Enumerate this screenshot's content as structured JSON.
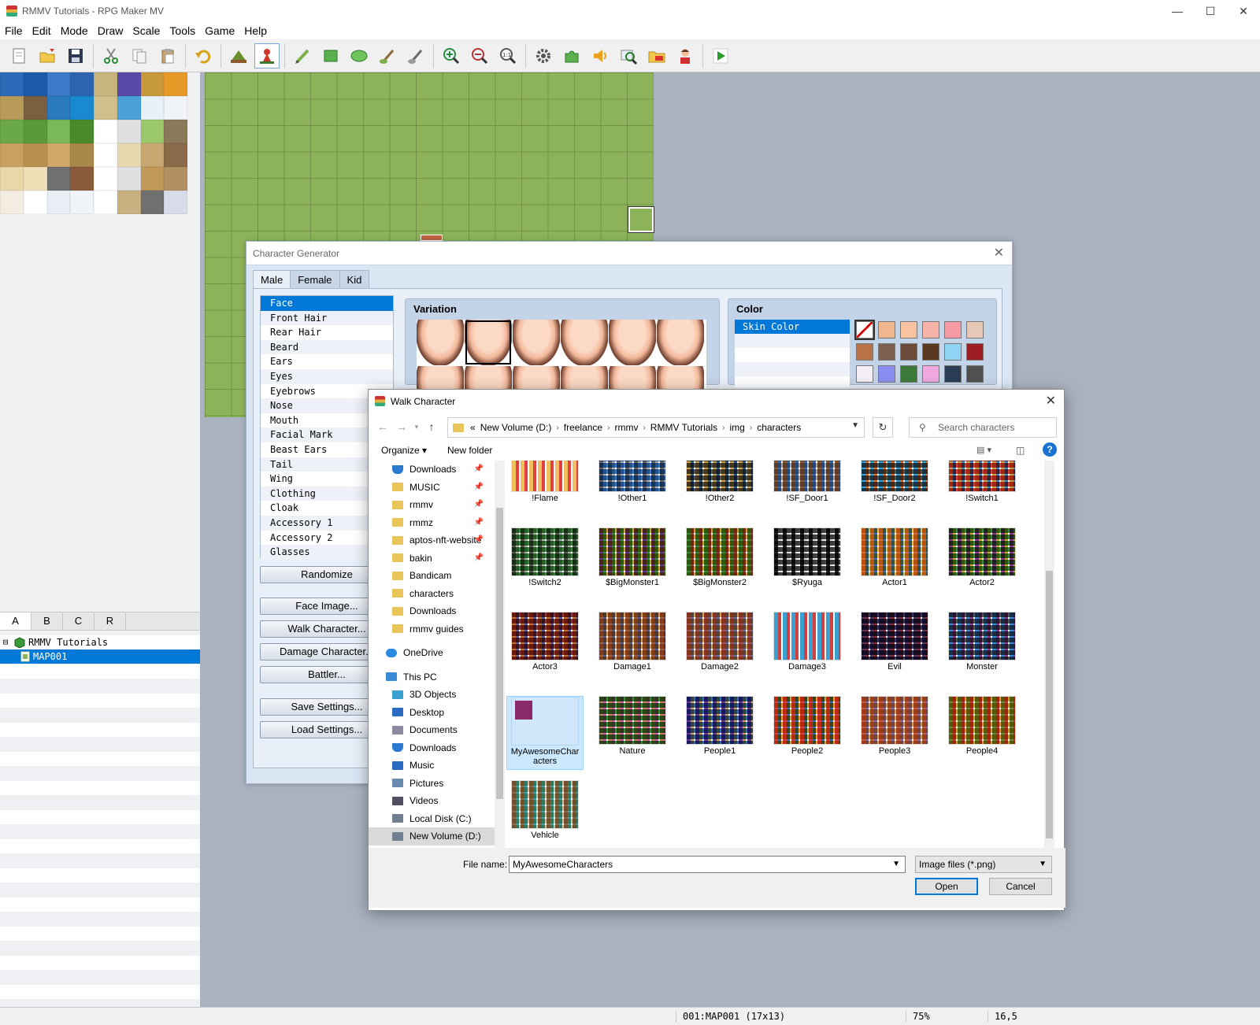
{
  "window": {
    "title": "RMMV Tutorials - RPG Maker MV",
    "min": "—",
    "max": "☐",
    "close": "✕"
  },
  "menu": [
    "File",
    "Edit",
    "Mode",
    "Draw",
    "Scale",
    "Tools",
    "Game",
    "Help"
  ],
  "layer_tabs": [
    "A",
    "B",
    "C",
    "R"
  ],
  "tree": {
    "project": "RMMV Tutorials",
    "map": "MAP001",
    "expander": "⊟"
  },
  "status": {
    "map": "001:MAP001 (17x13)",
    "zoom": "75%",
    "coords": "16,5"
  },
  "chargen": {
    "title": "Character Generator",
    "close": "✕",
    "tabs": [
      "Male",
      "Female",
      "Kid"
    ],
    "parts": [
      "Face",
      "Front Hair",
      "Rear Hair",
      "Beard",
      "Ears",
      "Eyes",
      "Eyebrows",
      "Nose",
      "Mouth",
      "Facial Mark",
      "Beast Ears",
      "Tail",
      "Wing",
      "Clothing",
      "Cloak",
      "Accessory 1",
      "Accessory 2",
      "Glasses"
    ],
    "buttons": {
      "randomize": "Randomize",
      "face_image": "Face Image...",
      "walk_character": "Walk Character...",
      "damage_character": "Damage Character...",
      "battler": "Battler...",
      "save_settings": "Save Settings...",
      "load_settings": "Load Settings..."
    },
    "variation_label": "Variation",
    "color_label": "Color",
    "color_list": [
      "Skin Color"
    ],
    "swatches": [
      "#ffffff",
      "#f0b68e",
      "#f7c3a0",
      "#f7b3a8",
      "#f59aa3",
      "#e7c7b6",
      "#b87348",
      "#7d5f4f",
      "#6b4a38",
      "#5a3720",
      "#8fd3f5",
      "#9c1c22",
      "#f2eef4",
      "#8a8ef0",
      "#3d7a3a",
      "#f0a8e0",
      "#2a3d55",
      "#505050"
    ]
  },
  "dialog": {
    "title": "Walk Character",
    "close": "✕",
    "path": [
      "New Volume (D:)",
      "freelance",
      "rmmv",
      "RMMV Tutorials",
      "img",
      "characters"
    ],
    "path_prefix": "«",
    "search_placeholder": "Search characters",
    "organize": "Organize ▾",
    "new_folder": "New folder",
    "nav": [
      {
        "label": "Downloads",
        "pin": true,
        "kind": "download"
      },
      {
        "label": "MUSIC",
        "pin": true,
        "kind": "folder"
      },
      {
        "label": "rmmv",
        "pin": true,
        "kind": "folder"
      },
      {
        "label": "rmmz",
        "pin": true,
        "kind": "folder"
      },
      {
        "label": "aptos-nft-website",
        "pin": true,
        "kind": "folder"
      },
      {
        "label": "bakin",
        "pin": true,
        "kind": "folder"
      },
      {
        "label": "Bandicam",
        "pin": false,
        "kind": "folder"
      },
      {
        "label": "characters",
        "pin": false,
        "kind": "folder"
      },
      {
        "label": "Downloads",
        "pin": false,
        "kind": "folder"
      },
      {
        "label": "rmmv guides",
        "pin": false,
        "kind": "folder"
      },
      {
        "label": "",
        "pin": false,
        "kind": "gap"
      },
      {
        "label": "OneDrive",
        "pin": false,
        "kind": "cloud"
      },
      {
        "label": "",
        "pin": false,
        "kind": "gap"
      },
      {
        "label": "This PC",
        "pin": false,
        "kind": "pc"
      },
      {
        "label": "3D Objects",
        "pin": false,
        "kind": "obj"
      },
      {
        "label": "Desktop",
        "pin": false,
        "kind": "desk"
      },
      {
        "label": "Documents",
        "pin": false,
        "kind": "doc"
      },
      {
        "label": "Downloads",
        "pin": false,
        "kind": "download"
      },
      {
        "label": "Music",
        "pin": false,
        "kind": "music"
      },
      {
        "label": "Pictures",
        "pin": false,
        "kind": "pic"
      },
      {
        "label": "Videos",
        "pin": false,
        "kind": "vid"
      },
      {
        "label": "Local Disk (C:)",
        "pin": false,
        "kind": "disk"
      },
      {
        "label": "New Volume (D:)",
        "pin": false,
        "kind": "disk",
        "selected": true
      }
    ],
    "files": [
      "!Flame",
      "!Other1",
      "!Other2",
      "!SF_Door1",
      "!SF_Door2",
      "!Switch1",
      "!Switch2",
      "$BigMonster1",
      "$BigMonster2",
      "$Ryuga",
      "Actor1",
      "Actor2",
      "Actor3",
      "Damage1",
      "Damage2",
      "Damage3",
      "Evil",
      "Monster",
      "MyAwesomeCharacters",
      "Nature",
      "People1",
      "People2",
      "People3",
      "People4",
      "Vehicle"
    ],
    "selected_file": "MyAwesomeCharacters",
    "file_name_label": "File name:",
    "file_name_value": "MyAwesomeCharacters",
    "file_type": "Image files (*.png)",
    "open": "Open",
    "cancel": "Cancel"
  }
}
